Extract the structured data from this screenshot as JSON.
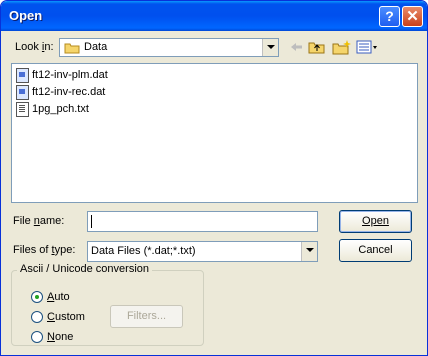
{
  "window": {
    "title": "Open",
    "help_glyph": "?",
    "close_glyph": "✕"
  },
  "look_in": {
    "label": "Look in:",
    "value": "Data"
  },
  "toolbar": {
    "back_icon": "back-arrow-icon",
    "up_icon": "up-folder-icon",
    "newfolder_icon": "new-folder-icon",
    "views_icon": "views-menu-icon"
  },
  "files": [
    {
      "name": "ft12-inv-plm.dat",
      "icon": "dat-file-icon"
    },
    {
      "name": "ft12-inv-rec.dat",
      "icon": "dat-file-icon"
    },
    {
      "name": "1pg_pch.txt",
      "icon": "txt-file-icon"
    }
  ],
  "file_name": {
    "label": "File name:",
    "value": ""
  },
  "file_type": {
    "label": "Files of type:",
    "value": "Data Files (*.dat;*.txt)"
  },
  "buttons": {
    "open": "Open",
    "cancel": "Cancel",
    "filters": "Filters..."
  },
  "conversion": {
    "title": "Ascii / Unicode conversion",
    "options": [
      {
        "label": "Auto",
        "checked": true
      },
      {
        "label": "Custom",
        "checked": false
      },
      {
        "label": "None",
        "checked": false
      }
    ]
  }
}
